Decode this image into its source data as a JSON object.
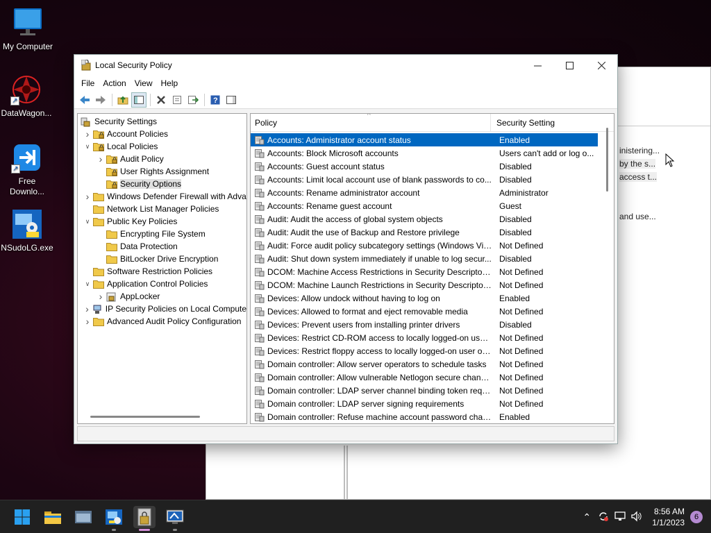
{
  "desktop": {
    "icons": [
      {
        "label": "My Computer",
        "icon": "monitor-icon"
      },
      {
        "label": "DataWagon...",
        "icon": "datawagon-icon"
      },
      {
        "label": "Free Downlo...",
        "icon": "download-icon"
      },
      {
        "label": "NSudoLG.exe",
        "icon": "nsudo-icon"
      }
    ]
  },
  "background_window": {
    "snippets": [
      "inistering...",
      "by the s...",
      "access t...",
      "and use..."
    ]
  },
  "window": {
    "title": "Local Security Policy",
    "menu": [
      "File",
      "Action",
      "View",
      "Help"
    ],
    "tree": [
      {
        "label": "Security Settings",
        "level": 0,
        "arrow": "",
        "icon": "shield-icon"
      },
      {
        "label": "Account Policies",
        "level": 1,
        "arrow": "collapsed",
        "icon": "folder-lock-icon"
      },
      {
        "label": "Local Policies",
        "level": 1,
        "arrow": "expanded",
        "icon": "folder-lock-icon"
      },
      {
        "label": "Audit Policy",
        "level": 2,
        "arrow": "collapsed",
        "icon": "folder-lock-icon"
      },
      {
        "label": "User Rights Assignment",
        "level": 2,
        "arrow": "",
        "icon": "folder-lock-icon"
      },
      {
        "label": "Security Options",
        "level": 2,
        "arrow": "",
        "icon": "folder-lock-icon",
        "selected": true
      },
      {
        "label": "Windows Defender Firewall with Adva",
        "level": 1,
        "arrow": "collapsed",
        "icon": "folder-icon"
      },
      {
        "label": "Network List Manager Policies",
        "level": 1,
        "arrow": "",
        "icon": "folder-icon"
      },
      {
        "label": "Public Key Policies",
        "level": 1,
        "arrow": "expanded",
        "icon": "folder-icon"
      },
      {
        "label": "Encrypting File System",
        "level": 2,
        "arrow": "",
        "icon": "folder-icon"
      },
      {
        "label": "Data Protection",
        "level": 2,
        "arrow": "",
        "icon": "folder-icon"
      },
      {
        "label": "BitLocker Drive Encryption",
        "level": 2,
        "arrow": "",
        "icon": "folder-icon"
      },
      {
        "label": "Software Restriction Policies",
        "level": 1,
        "arrow": "",
        "icon": "folder-icon"
      },
      {
        "label": "Application Control Policies",
        "level": 1,
        "arrow": "expanded",
        "icon": "folder-icon"
      },
      {
        "label": "AppLocker",
        "level": 2,
        "arrow": "collapsed",
        "icon": "applocker-icon"
      },
      {
        "label": "IP Security Policies on Local Compute",
        "level": 1,
        "arrow": "collapsed",
        "icon": "ipsec-icon"
      },
      {
        "label": "Advanced Audit Policy Configuration",
        "level": 1,
        "arrow": "collapsed",
        "icon": "folder-icon"
      }
    ],
    "columns": {
      "policy": "Policy",
      "setting": "Security Setting"
    },
    "rows": [
      {
        "policy": "Accounts: Administrator account status",
        "setting": "Enabled",
        "selected": true
      },
      {
        "policy": "Accounts: Block Microsoft accounts",
        "setting": "Users can't add or log o..."
      },
      {
        "policy": "Accounts: Guest account status",
        "setting": "Disabled"
      },
      {
        "policy": "Accounts: Limit local account use of blank passwords to co...",
        "setting": "Disabled"
      },
      {
        "policy": "Accounts: Rename administrator account",
        "setting": "Administrator"
      },
      {
        "policy": "Accounts: Rename guest account",
        "setting": "Guest"
      },
      {
        "policy": "Audit: Audit the access of global system objects",
        "setting": "Disabled"
      },
      {
        "policy": "Audit: Audit the use of Backup and Restore privilege",
        "setting": "Disabled"
      },
      {
        "policy": "Audit: Force audit policy subcategory settings (Windows Vis...",
        "setting": "Not Defined"
      },
      {
        "policy": "Audit: Shut down system immediately if unable to log secur...",
        "setting": "Disabled"
      },
      {
        "policy": "DCOM: Machine Access Restrictions in Security Descriptor D...",
        "setting": "Not Defined"
      },
      {
        "policy": "DCOM: Machine Launch Restrictions in Security Descriptor ...",
        "setting": "Not Defined"
      },
      {
        "policy": "Devices: Allow undock without having to log on",
        "setting": "Enabled"
      },
      {
        "policy": "Devices: Allowed to format and eject removable media",
        "setting": "Not Defined"
      },
      {
        "policy": "Devices: Prevent users from installing printer drivers",
        "setting": "Disabled"
      },
      {
        "policy": "Devices: Restrict CD-ROM access to locally logged-on user ...",
        "setting": "Not Defined"
      },
      {
        "policy": "Devices: Restrict floppy access to locally logged-on user only",
        "setting": "Not Defined"
      },
      {
        "policy": "Domain controller: Allow server operators to schedule tasks",
        "setting": "Not Defined"
      },
      {
        "policy": "Domain controller: Allow vulnerable Netlogon secure chann...",
        "setting": "Not Defined"
      },
      {
        "policy": "Domain controller: LDAP server channel binding token requi...",
        "setting": "Not Defined"
      },
      {
        "policy": "Domain controller: LDAP server signing requirements",
        "setting": "Not Defined"
      },
      {
        "policy": "Domain controller: Refuse machine account password chan...",
        "setting": "Enabled"
      }
    ]
  },
  "taskbar": {
    "time": "8:56 AM",
    "date": "1/1/2023",
    "notification_count": "6"
  },
  "colors": {
    "selection": "#0067c0",
    "taskbar": "#202020"
  }
}
